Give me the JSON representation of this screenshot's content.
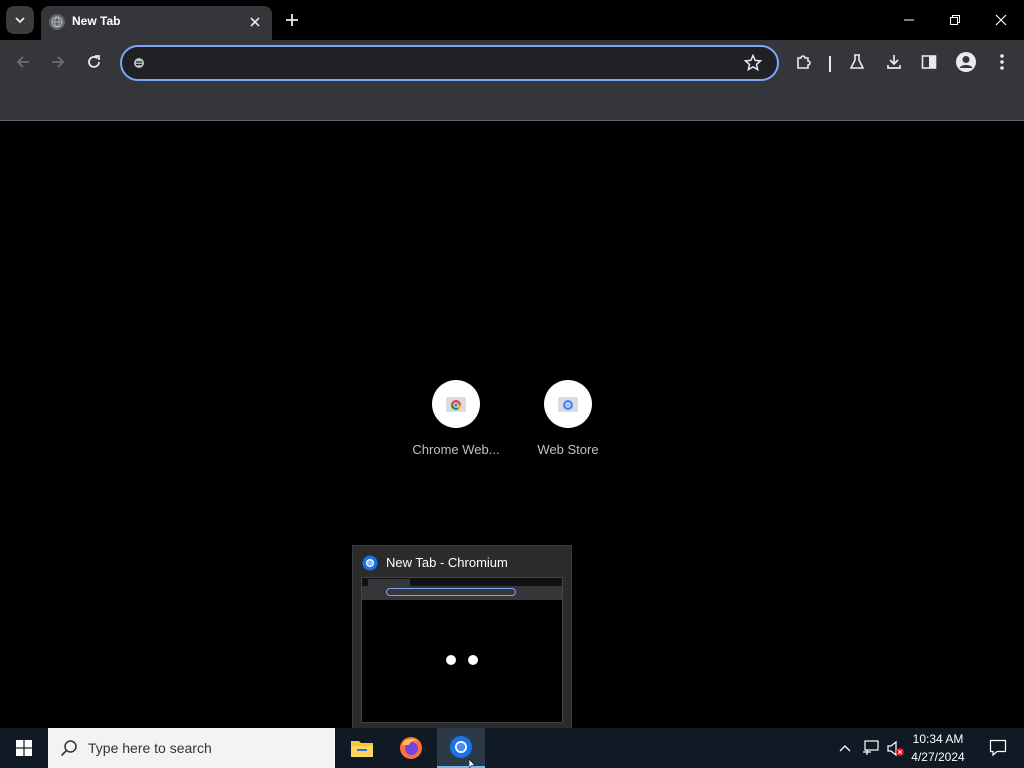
{
  "tab": {
    "title": "New Tab"
  },
  "omnibox": {
    "value": "",
    "placeholder": ""
  },
  "ntp": {
    "shortcuts": [
      {
        "label": "Chrome Web..."
      },
      {
        "label": "Web Store"
      }
    ]
  },
  "preview": {
    "title": "New Tab - Chromium"
  },
  "taskbar": {
    "search_placeholder": "Type here to search",
    "time": "10:34 AM",
    "date": "4/27/2024"
  },
  "icons": [
    "tab-search-icon",
    "globe-icon",
    "close-icon",
    "plus-icon",
    "minimize-icon",
    "restore-icon",
    "back-icon",
    "forward-icon",
    "reload-icon",
    "star-icon",
    "extensions-icon",
    "labs-icon",
    "download-icon",
    "side-panel-icon",
    "profile-icon",
    "menu-icon",
    "windows-start-icon",
    "search-icon",
    "file-explorer-icon",
    "firefox-icon",
    "chromium-icon",
    "chevron-up-icon",
    "network-icon",
    "volume-muted-icon",
    "notification-icon"
  ],
  "colors": {
    "accent": "#7ca6f6",
    "toolbar": "#35363a",
    "background": "#000000",
    "taskbar": "#0f1a24"
  }
}
